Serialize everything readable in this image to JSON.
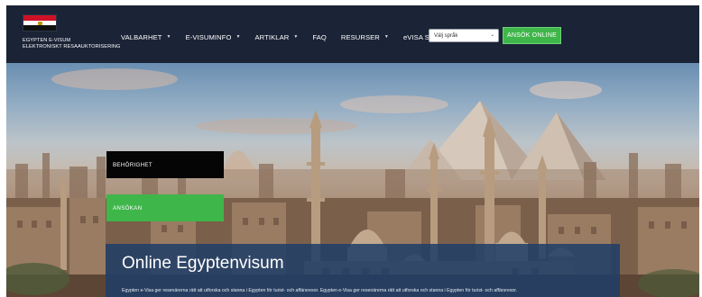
{
  "brand": {
    "line1": "EGYPTEN E-VISUM",
    "line2": "ELEKTRONISKT RESAAUKTORISERING"
  },
  "nav": {
    "items": [
      {
        "label": "VALBARHET",
        "dropdown": true
      },
      {
        "label": "E-VISUMINFO",
        "dropdown": true
      },
      {
        "label": "ARTIKLAR",
        "dropdown": true
      },
      {
        "label": "FAQ",
        "dropdown": false
      },
      {
        "label": "RESURSER",
        "dropdown": true
      },
      {
        "label": "eVISA STATUS",
        "dropdown": false
      }
    ],
    "caret": "▼"
  },
  "language": {
    "selected": "Välj språk",
    "chevron": "⌄"
  },
  "cta": {
    "label": "ANSÖK ONLINE"
  },
  "hero": {
    "eligibility_label": "BEHÖRIGHET",
    "apply_label": "ANSÖKAN",
    "title": "Online Egyptenvisum",
    "subtitle": "Egypten e-Visa ger resenärerna rätt att utforska och stanna i Egypten för turist- och affärsresor. Egypten e-Visa ger resenärerna rätt att utforska och stanna i Egypten för turist- och affärsresor."
  },
  "colors": {
    "header_bg": "#1b2336",
    "accent_green": "#3fb64a",
    "panel_blue": "#1e3e68",
    "eligibility_bg": "#050505"
  },
  "icons": {
    "flag": "egypt-flag-icon",
    "caret": "caret-down-icon",
    "select_chevron": "chevron-down-icon"
  }
}
